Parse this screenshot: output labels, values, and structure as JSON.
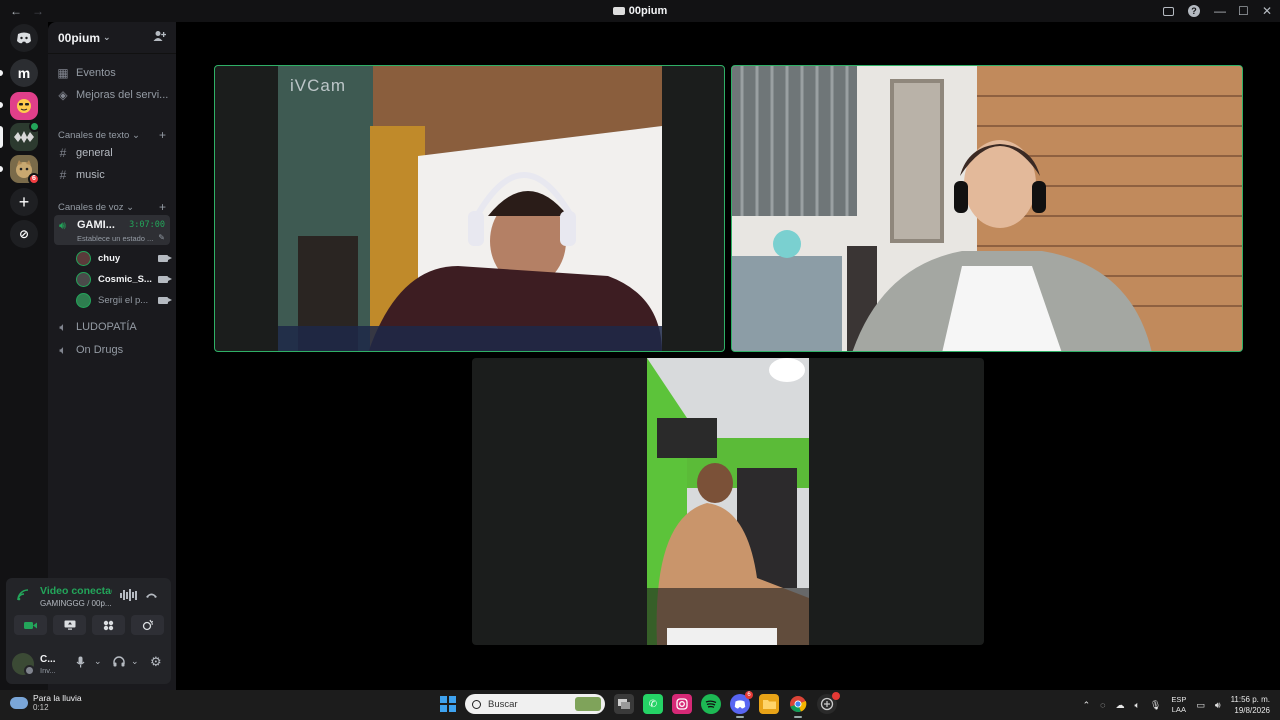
{
  "window": {
    "title": "00pium",
    "nav_back": "←",
    "nav_fwd": "→",
    "minimize": "—",
    "maximize": "☐",
    "close": "✕"
  },
  "rail": {
    "dm_icon": "discord-icon",
    "m_label": "m",
    "badge_count": "6",
    "add_icon": "+",
    "discover_icon": "⊘"
  },
  "server": {
    "name": "00pium",
    "caret": "⌄"
  },
  "nav": {
    "events": "Eventos",
    "boosts": "Mejoras del servi..."
  },
  "text_category": {
    "label": "Canales de texto",
    "chevron": "⌄",
    "add": "+"
  },
  "text_channels": [
    {
      "hash": "#",
      "name": "general"
    },
    {
      "hash": "#",
      "name": "music"
    }
  ],
  "voice_category": {
    "label": "Canales de voz",
    "chevron": "⌄",
    "add": "+"
  },
  "active_voice": {
    "name": "GAMI...",
    "timer": "3:07:00",
    "status": "Establece un estado ...",
    "pencil": "✎"
  },
  "voice_users": [
    {
      "name": "chuy",
      "avatar_color": "#5a3a3a"
    },
    {
      "name": "Cosmic_S...",
      "avatar_color": "#4a4a4a"
    },
    {
      "name": "Sergii el p...",
      "avatar_color": "#2e7d4f"
    }
  ],
  "other_voice": [
    {
      "name": "LUDOPATÍA"
    },
    {
      "name": "On Drugs"
    }
  ],
  "voice_panel": {
    "title": "Video conectad",
    "subtitle": "GAMINGGG / 00p...",
    "user_name": "C...",
    "user_status": "Inv..."
  },
  "tiles": [
    {
      "watermark": "iVCam",
      "speaking": true
    },
    {
      "speaking": true
    },
    {
      "speaking": false
    }
  ],
  "taskbar": {
    "weather_line1": "Para la lluvia",
    "weather_line2": "0:12",
    "search_placeholder": "Buscar",
    "discord_badge": "6",
    "lang1": "ESP",
    "lang2": "LAA",
    "time": "11:56 p. m.",
    "date": "19/8/2026"
  },
  "colors": {
    "accent_green": "#23a55a",
    "speaking_border": "#2fb066",
    "sidebar_bg": "#1a1a1e",
    "rail_bg": "#121214"
  }
}
